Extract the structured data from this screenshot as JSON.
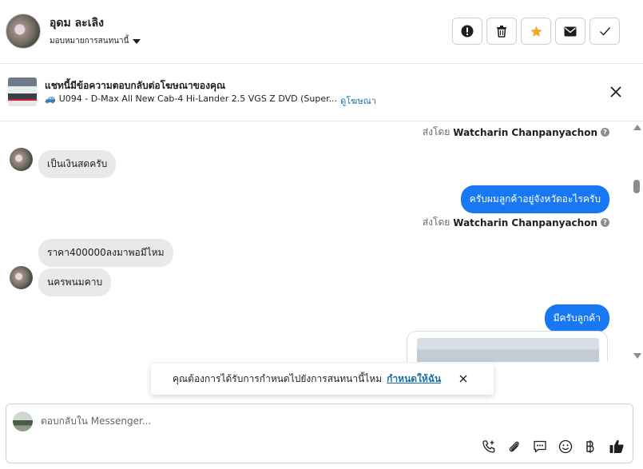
{
  "header": {
    "contact_name": "อุดม ละเลิง",
    "assign_label": "มอบหมายการสนทนานี้",
    "buttons": [
      {
        "name": "report-button",
        "icon": "exclamation-circle-icon"
      },
      {
        "name": "delete-button",
        "icon": "trash-icon"
      },
      {
        "name": "star-button",
        "icon": "star-icon",
        "color": "#f5a623"
      },
      {
        "name": "mark-unread-button",
        "icon": "envelope-icon"
      },
      {
        "name": "mark-done-button",
        "icon": "check-icon"
      }
    ]
  },
  "ad_banner": {
    "title": "แชทนี้มีข้อความตอบกลับต่อโฆษณาของคุณ",
    "vehicle_emoji": "🚙",
    "subtitle": "U094 - D-Max All New Cab-4 Hi-Lander 2.5 VGS Z DVD (Super...",
    "link": "ดูโฆษณา"
  },
  "messages": {
    "sent_by_prefix_1": "ส่งโดย",
    "sent_by_name_1": "Watcharin Chanpanyachon",
    "incoming_1": "เป็นเงินสดครับ",
    "outgoing_1": "ครับผมลูกค้าอยู่จังหวัดอะไรครับ",
    "sent_by_prefix_2": "ส่งโดย",
    "sent_by_name_2": "Watcharin Chanpanyachon",
    "incoming_2": "ราคา400000ลงมาพอมีไหม",
    "incoming_3": "นครพนมคาบ",
    "outgoing_2": "มีครับลูกค้า"
  },
  "toast": {
    "text": "คุณต้องการได้รับการกำหนดไปยังการสนทนานี้ไหม",
    "action": "กำหนดให้ฉัน"
  },
  "composer": {
    "placeholder": "ตอบกลับใน Messenger...",
    "tools": [
      "phone-plus-icon",
      "paperclip-icon",
      "saved-reply-icon",
      "emoji-icon",
      "baht-icon",
      "thumbs-up-icon"
    ]
  },
  "colors": {
    "accent": "#1877f2",
    "link": "#1d6fa5",
    "star": "#f5a623",
    "incoming_bubble": "#e9e9eb"
  }
}
